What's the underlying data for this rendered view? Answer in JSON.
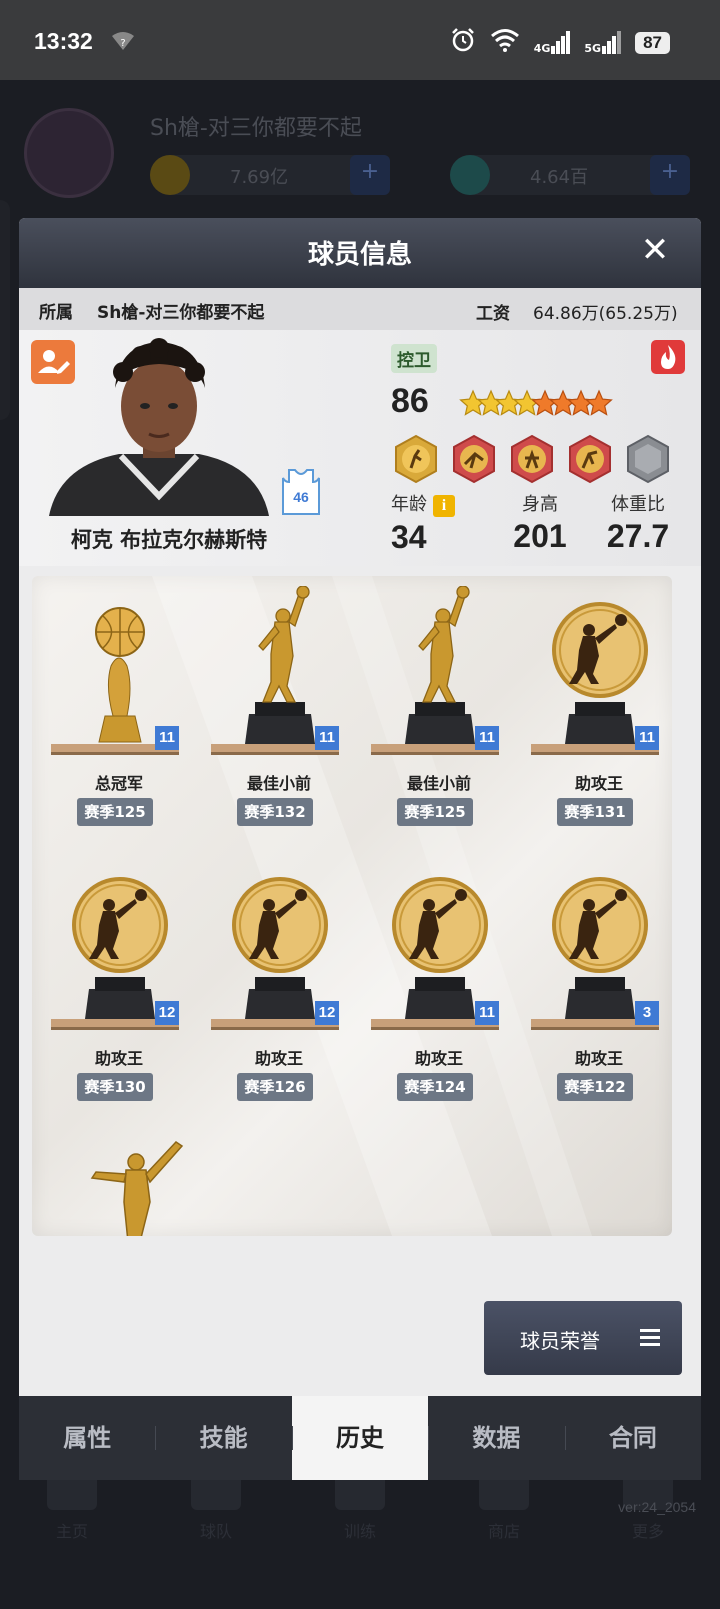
{
  "status_bar": {
    "time": "13:32",
    "notif_icon": "wifi-question-icon",
    "network_1": "4G",
    "network_2": "5G",
    "battery": "87"
  },
  "background_app": {
    "team_name": "Sh槍-对三你都要不起",
    "coins": "7.69亿",
    "gems": "4.64百",
    "version": "ver:24_2054",
    "nav": [
      "主页",
      "球队",
      "训练",
      "商店",
      "更多"
    ]
  },
  "modal": {
    "title": "球员信息",
    "close_icon": "close-icon",
    "team_label": "所属",
    "team_value": "Sh槍-对三你都要不起",
    "salary_label": "工资",
    "salary_value": "64.86万(65.25万)",
    "player": {
      "name": "柯克 布拉克尔赫斯特",
      "jersey_number": "46",
      "position": "控卫",
      "overall": "86",
      "stars_gold": 4,
      "stars_orange": 4,
      "age_label": "年龄",
      "age": "34",
      "height_label": "身高",
      "height": "201",
      "bmi_label": "体重比",
      "bmi": "27.7"
    },
    "trophies": [
      {
        "name": "总冠军",
        "season": "赛季125",
        "count": "11",
        "type": "championship"
      },
      {
        "name": "最佳小前",
        "season": "赛季132",
        "count": "11",
        "type": "player"
      },
      {
        "name": "最佳小前",
        "season": "赛季125",
        "count": "11",
        "type": "player"
      },
      {
        "name": "助攻王",
        "season": "赛季131",
        "count": "11",
        "type": "medal"
      },
      {
        "name": "助攻王",
        "season": "赛季130",
        "count": "12",
        "type": "medal"
      },
      {
        "name": "助攻王",
        "season": "赛季126",
        "count": "12",
        "type": "medal"
      },
      {
        "name": "助攻王",
        "season": "赛季124",
        "count": "11",
        "type": "medal"
      },
      {
        "name": "助攻王",
        "season": "赛季122",
        "count": "3",
        "type": "medal"
      }
    ],
    "honor_button": "球员荣誉",
    "tabs": [
      {
        "label": "属性",
        "active": false
      },
      {
        "label": "技能",
        "active": false
      },
      {
        "label": "历史",
        "active": true
      },
      {
        "label": "数据",
        "active": false
      },
      {
        "label": "合同",
        "active": false
      }
    ],
    "colors": {
      "accent_blue": "#3f7ad4",
      "header": "#3b3f4b",
      "season_badge": "#6d7785",
      "edit_orange": "#ec7a3c",
      "fire_red": "#e03a3a"
    }
  }
}
